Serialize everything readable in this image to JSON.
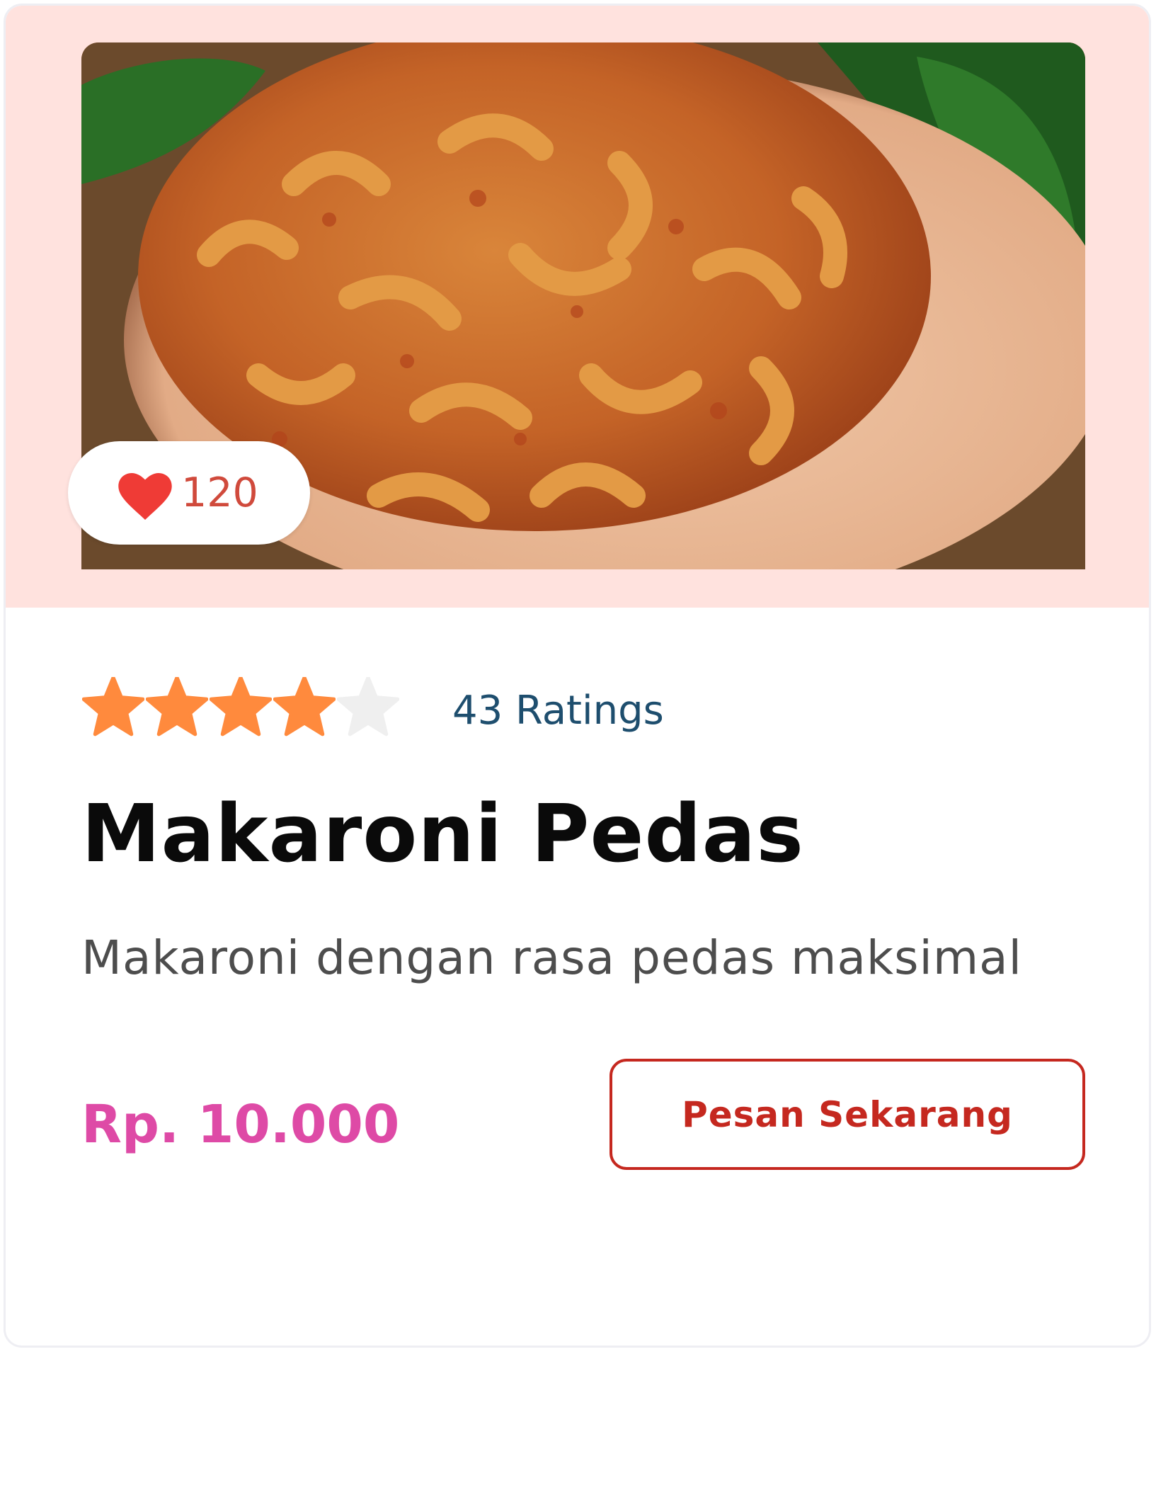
{
  "product": {
    "name": "Makaroni Pedas",
    "description": "Makaroni dengan rasa pedas maksimal",
    "price": "Rp. 10.000",
    "likes": "120",
    "rating": {
      "value": 4,
      "max": 5,
      "label": "43 Ratings"
    },
    "image_icon": "food-photo"
  },
  "actions": {
    "order_label": "Pesan Sekarang"
  },
  "colors": {
    "image_bg": "#ffe2de",
    "heart": "#ef3b36",
    "like_count": "#d04a3c",
    "star_filled": "#ff8a3d",
    "star_empty": "#efefef",
    "ratings_text": "#1e4e6e",
    "title": "#0a0a0a",
    "description": "#4d4d4d",
    "price": "#de4aa6",
    "button": "#c5281f"
  }
}
